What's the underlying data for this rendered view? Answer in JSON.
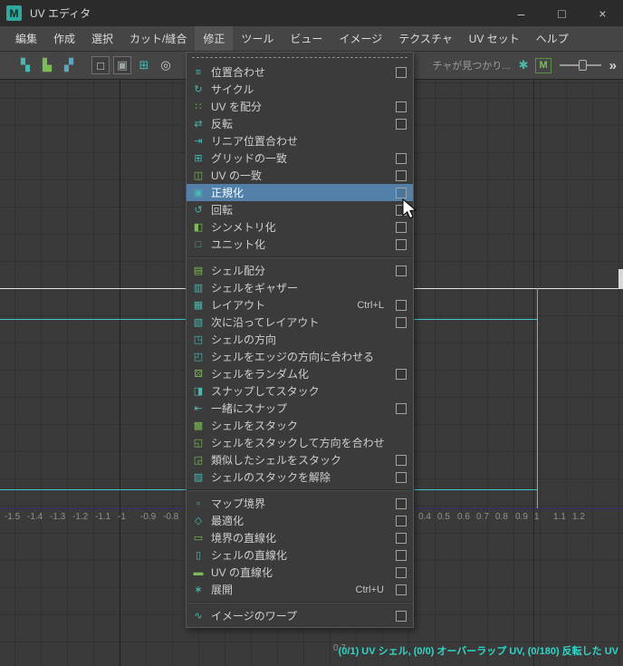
{
  "window": {
    "title": "UV エディタ",
    "icon_letter": "M",
    "controls": {
      "minimize": "–",
      "maximize": "□",
      "close": "×"
    }
  },
  "menubar": {
    "active": "modify",
    "items": [
      {
        "id": "edit",
        "label": "編集"
      },
      {
        "id": "create",
        "label": "作成"
      },
      {
        "id": "select",
        "label": "選択"
      },
      {
        "id": "cut-sew",
        "label": "カット/縫合"
      },
      {
        "id": "modify",
        "label": "修正"
      },
      {
        "id": "tools",
        "label": "ツール"
      },
      {
        "id": "view",
        "label": "ビュー"
      },
      {
        "id": "image",
        "label": "イメージ"
      },
      {
        "id": "texture",
        "label": "テクスチャ"
      },
      {
        "id": "uv-set",
        "label": "UV セット"
      },
      {
        "id": "help",
        "label": "ヘルプ"
      }
    ]
  },
  "toolbar": {
    "message": "チャが見つかり...",
    "overflow_glyph": "»",
    "slider": {
      "name": "image-dim-slider",
      "value": 58
    },
    "left_icons": [
      {
        "name": "uv-transform-icon",
        "glyph": "▚",
        "color": "teal"
      },
      {
        "name": "uv-shells-icon",
        "glyph": "▙",
        "color": "green"
      },
      {
        "name": "uv-distortion-icon",
        "glyph": "▞",
        "color": "#5aa7c0"
      },
      {
        "separator": true
      },
      {
        "name": "shaded-uvs-toggle-icon",
        "glyph": "□",
        "color": "#d0d8d8",
        "boxed": true
      },
      {
        "name": "texture-borders-toggle-icon",
        "glyph": "▣",
        "color": "#9aa5a5",
        "boxed": true
      },
      {
        "name": "grid-toggle-icon",
        "glyph": "⊞",
        "color": "teal"
      },
      {
        "name": "pixel-snap-toggle-icon",
        "glyph": "◎",
        "color": "#cfcfcf"
      }
    ],
    "right_icons": [
      {
        "name": "texture-checker-icon",
        "glyph": "✱",
        "color": "teal"
      },
      {
        "name": "material-m-icon",
        "glyph": "M",
        "color": "green",
        "framed": true
      }
    ]
  },
  "modify_menu": {
    "items": [
      {
        "id": "align",
        "label": "位置合わせ",
        "icon": "align-icon",
        "glyph": "≡",
        "color": "teal",
        "checkbox": true
      },
      {
        "id": "cycle",
        "label": "サイクル",
        "icon": "cycle-icon",
        "glyph": "↻",
        "color": "teal",
        "checkbox": false
      },
      {
        "id": "distribute-uvs",
        "label": "UV を配分",
        "icon": "distribute-uvs-icon",
        "glyph": "∷",
        "color": "green",
        "checkbox": true
      },
      {
        "id": "flip",
        "label": "反転",
        "icon": "flip-icon",
        "glyph": "⇄",
        "color": "teal",
        "checkbox": true
      },
      {
        "id": "linear-align",
        "label": "リニア位置合わせ",
        "icon": "linear-align-icon",
        "glyph": "⇥",
        "color": "teal",
        "checkbox": false
      },
      {
        "id": "match-grid",
        "label": "グリッドの一致",
        "icon": "match-grid-icon",
        "glyph": "⊞",
        "color": "teal",
        "checkbox": true
      },
      {
        "id": "match-uvs",
        "label": "UV の一致",
        "icon": "match-uvs-icon",
        "glyph": "◫",
        "color": "green",
        "checkbox": true
      },
      {
        "id": "normalize",
        "label": "正規化",
        "icon": "normalize-icon",
        "glyph": "▣",
        "color": "teal",
        "checkbox": true,
        "highlighted": true
      },
      {
        "id": "rotate",
        "label": "回転",
        "icon": "rotate-icon",
        "glyph": "↺",
        "color": "teal",
        "checkbox": true
      },
      {
        "id": "symmetrize",
        "label": "シンメトリ化",
        "icon": "symmetrize-icon",
        "glyph": "◧",
        "color": "green",
        "checkbox": true
      },
      {
        "id": "unitize",
        "label": "ユニット化",
        "icon": "unitize-icon",
        "glyph": "□",
        "color": "teal",
        "checkbox": true
      },
      {
        "sep": true
      },
      {
        "id": "distribute-shells",
        "label": "シェル配分",
        "icon": "distribute-shells-icon",
        "glyph": "▤",
        "color": "green",
        "checkbox": true
      },
      {
        "id": "gather-shells",
        "label": "シェルをギャザー",
        "icon": "gather-shells-icon",
        "glyph": "▥",
        "color": "teal",
        "checkbox": false
      },
      {
        "id": "layout",
        "label": "レイアウト",
        "icon": "layout-icon",
        "glyph": "▦",
        "color": "teal",
        "checkbox": true,
        "shortcut": "Ctrl+L"
      },
      {
        "id": "layout-along",
        "label": "次に沿ってレイアウト",
        "icon": "layout-along-icon",
        "glyph": "▧",
        "color": "teal",
        "checkbox": true
      },
      {
        "id": "orient-shells",
        "label": "シェルの方向",
        "icon": "orient-shells-icon",
        "glyph": "◳",
        "color": "teal",
        "checkbox": false
      },
      {
        "id": "orient-to-edges",
        "label": "シェルをエッジの方向に合わせる",
        "icon": "orient-to-edges-icon",
        "glyph": "◰",
        "color": "teal",
        "checkbox": false
      },
      {
        "id": "randomize-shells",
        "label": "シェルをランダム化",
        "icon": "randomize-shells-icon",
        "glyph": "⚄",
        "color": "green",
        "checkbox": true
      },
      {
        "id": "snap-and-stack",
        "label": "スナップしてスタック",
        "icon": "snap-and-stack-icon",
        "glyph": "◨",
        "color": "teal",
        "checkbox": false
      },
      {
        "id": "snap-together",
        "label": "一緒にスナップ",
        "icon": "snap-together-icon",
        "glyph": "⇤",
        "color": "teal",
        "checkbox": true
      },
      {
        "id": "stack-shells",
        "label": "シェルをスタック",
        "icon": "stack-shells-icon",
        "glyph": "▩",
        "color": "green",
        "checkbox": false
      },
      {
        "id": "stack-and-orient",
        "label": "シェルをスタックして方向を合わせる",
        "icon": "stack-and-orient-icon",
        "glyph": "◱",
        "color": "green",
        "checkbox": false
      },
      {
        "id": "stack-similar",
        "label": "類似したシェルをスタック",
        "icon": "stack-similar-icon",
        "glyph": "◲",
        "color": "green",
        "checkbox": true
      },
      {
        "id": "unstack-shells",
        "label": "シェルのスタックを解除",
        "icon": "unstack-shells-icon",
        "glyph": "▨",
        "color": "teal",
        "checkbox": true
      },
      {
        "sep": true
      },
      {
        "id": "map-border",
        "label": "マップ境界",
        "icon": "map-border-icon",
        "glyph": "▫",
        "color": "teal",
        "checkbox": true
      },
      {
        "id": "optimize",
        "label": "最適化",
        "icon": "optimize-icon",
        "glyph": "◇",
        "color": "teal",
        "checkbox": true
      },
      {
        "id": "straighten-border",
        "label": "境界の直線化",
        "icon": "straighten-border-icon",
        "glyph": "▭",
        "color": "green",
        "checkbox": true
      },
      {
        "id": "straighten-shell",
        "label": "シェルの直線化",
        "icon": "straighten-shell-icon",
        "glyph": "▯",
        "color": "teal",
        "checkbox": true
      },
      {
        "id": "straighten-uvs",
        "label": "UV の直線化",
        "icon": "straighten-uvs-icon",
        "glyph": "▬",
        "color": "green",
        "checkbox": true
      },
      {
        "id": "unfold",
        "label": "展開",
        "icon": "unfold-icon",
        "glyph": "∗",
        "color": "teal",
        "checkbox": true,
        "shortcut": "Ctrl+U"
      },
      {
        "sep": true
      },
      {
        "id": "warp-image",
        "label": "イメージのワープ",
        "icon": "warp-image-icon",
        "glyph": "∿",
        "color": "teal",
        "checkbox": true
      }
    ]
  },
  "editor": {
    "x_axis_labels_left": [
      "-1.5",
      "-1.4",
      "-1.3",
      "-1.2",
      "-1.1",
      "-1",
      "-0.9",
      "-0.8"
    ],
    "x_axis_labels_right": [
      "0.4",
      "0.5",
      "0.6",
      "0.7",
      "0.8",
      "0.9",
      "1",
      "1.1",
      "1.2"
    ],
    "y_axis_label": "0.7",
    "status": "(0/1) UV シェル, (0/0) オーバーラップ UV, (0/180) 反転した UV"
  },
  "colors": {
    "teal_icon": "#49b8b0",
    "green_icon": "#7cbc55",
    "highlight": "#5280a8",
    "status_text": "#30d5c8",
    "shell_line": "#3fc8cf",
    "axis_line": "#2f2f6e",
    "grid_bg": "#3a3a3a",
    "titlebar_bg": "#2b2b2b"
  }
}
